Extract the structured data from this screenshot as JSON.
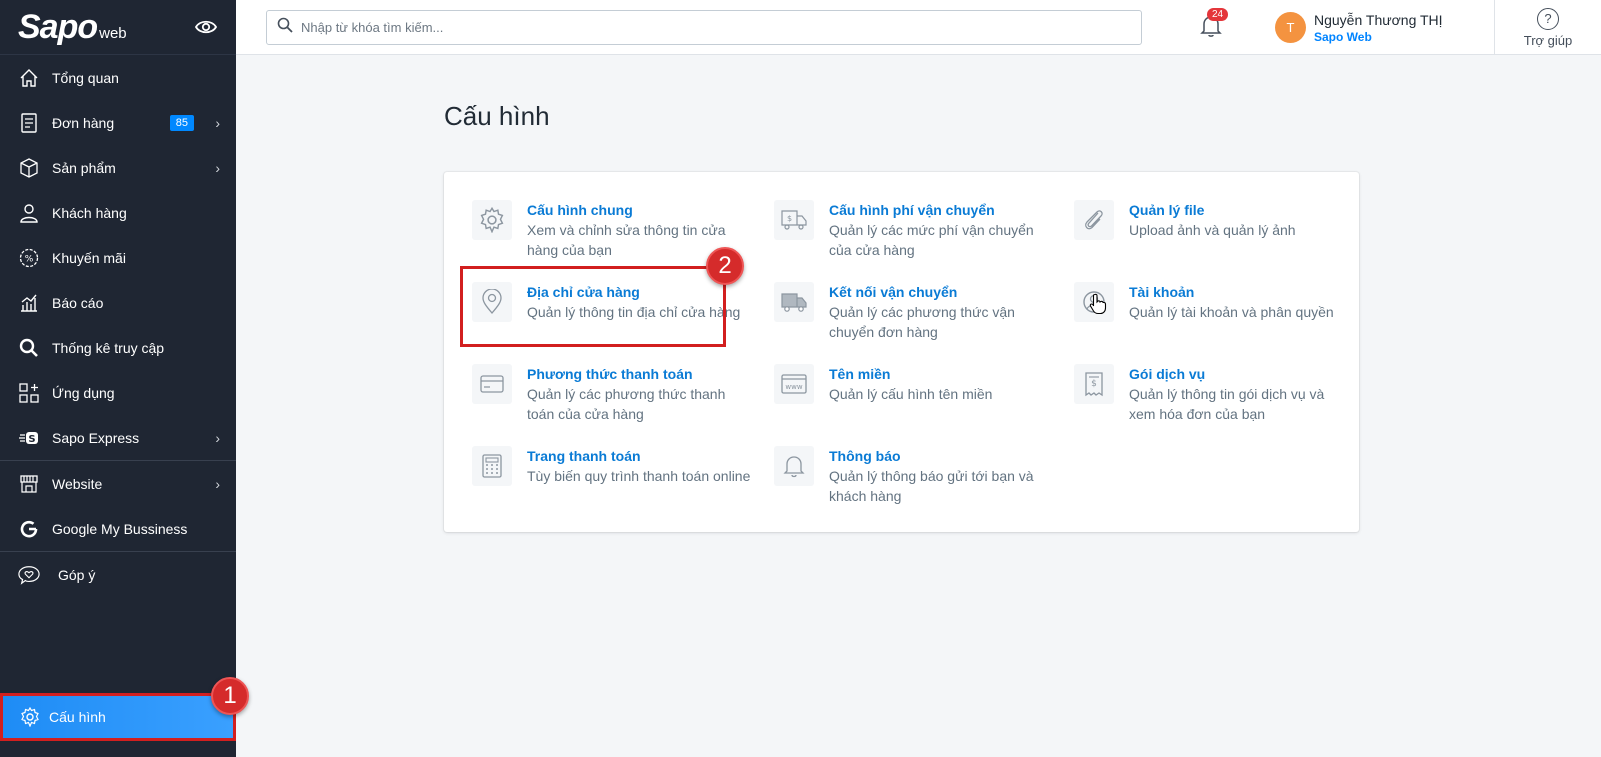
{
  "sidebar": {
    "logo_main": "Sapo",
    "logo_sub": "web",
    "items": [
      {
        "label": "Tổng quan"
      },
      {
        "label": "Đơn hàng",
        "badge": "85"
      },
      {
        "label": "Sản phẩm"
      },
      {
        "label": "Khách hàng"
      },
      {
        "label": "Khuyến mãi"
      },
      {
        "label": "Báo cáo"
      },
      {
        "label": "Thống kê truy cập"
      },
      {
        "label": "Ứng dụng"
      },
      {
        "label": "Sapo Express"
      },
      {
        "label": "Website"
      },
      {
        "label": "Google My Bussiness"
      },
      {
        "label": "Góp ý"
      }
    ],
    "settings_label": "Cấu hình"
  },
  "header": {
    "search_placeholder": "Nhập từ khóa tìm kiếm...",
    "notification_count": "24",
    "avatar_initial": "T",
    "user_name": "Nguyễn Thương THỊ",
    "store_name": "Sapo Web",
    "help_label": "Trợ giúp"
  },
  "main": {
    "title": "Cấu hình",
    "settings": [
      {
        "title": "Cấu hình chung",
        "desc": "Xem và chỉnh sửa thông tin cửa hàng của bạn",
        "icon": "gear-icon"
      },
      {
        "title": "Cấu hình phí vận chuyển",
        "desc": "Quản lý các mức phí vận chuyển của cửa hàng",
        "icon": "shipping-fee-icon"
      },
      {
        "title": "Quản lý file",
        "desc": "Upload ảnh và quản lý ảnh",
        "icon": "paperclip-icon"
      },
      {
        "title": "Địa chỉ cửa hàng",
        "desc": "Quản lý thông tin địa chỉ cửa hàng",
        "icon": "location-pin-icon"
      },
      {
        "title": "Kết nối vận chuyển",
        "desc": "Quản lý các phương thức vận chuyển đơn hàng",
        "icon": "truck-icon"
      },
      {
        "title": "Tài khoản",
        "desc": "Quản lý tài khoản và phân quyền",
        "icon": "account-icon"
      },
      {
        "title": "Phương thức thanh toán",
        "desc": "Quản lý các phương thức thanh toán của cửa hàng",
        "icon": "credit-card-icon"
      },
      {
        "title": "Tên miền",
        "desc": "Quản lý cấu hình tên miền",
        "icon": "domain-icon"
      },
      {
        "title": "Gói dịch vụ",
        "desc": "Quản lý thông tin gói dịch vụ và xem hóa đơn của bạn",
        "icon": "invoice-icon"
      },
      {
        "title": "Trang thanh toán",
        "desc": "Tùy biến quy trình thanh toán online",
        "icon": "checkout-icon"
      },
      {
        "title": "Thông báo",
        "desc": "Quản lý thông báo gửi tới bạn và khách hàng",
        "icon": "bell-icon"
      }
    ]
  },
  "annotations": {
    "step1": "1",
    "step2": "2"
  }
}
